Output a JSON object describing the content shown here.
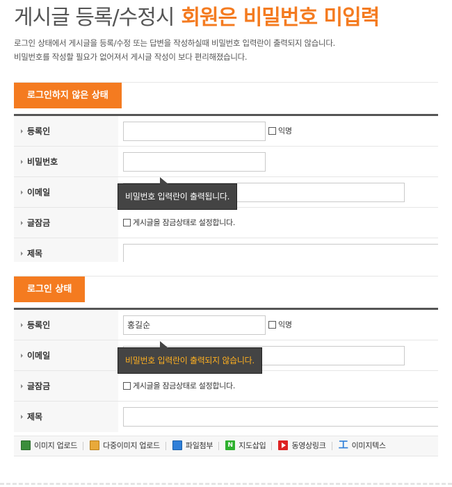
{
  "header": {
    "title_gray": "게시글 등록/수정시",
    "title_orange": "회원은 비밀번호 미입력"
  },
  "description": {
    "line1": "로그인 상태에서 게시글을 등록/수정 또는 답변을 작성하실때 비밀번호 입력란이 출력되지 않습니다.",
    "line2": "비밀번호를 작성할 필요가 없어져서 게시글 작성이 보다 편리해졌습니다."
  },
  "panel_logged_out": {
    "tag": "로그인하지 않은 상태",
    "rows": {
      "author": "등록인",
      "password": "비밀번호",
      "email": "이메일",
      "lock": "글잠금",
      "subject": "제목"
    },
    "anonymous_label": "익명",
    "lock_checkbox_label": "게시글을 잠금상태로 설정합니다.",
    "tooltip": "비밀번호 입력란이 출력됩니다."
  },
  "panel_logged_in": {
    "tag": "로그인 상태",
    "rows": {
      "author": "등록인",
      "email": "이메일",
      "lock": "글잠금",
      "subject": "제목"
    },
    "author_value": "홍길순",
    "anonymous_label": "익명",
    "lock_checkbox_label": "게시글을 잠금상태로 설정합니다.",
    "tooltip": "비밀번호 입력란이 출력되지 않습니다."
  },
  "toolbar": {
    "image_upload": "이미지 업로드",
    "multi_image_upload": "다중이미지 업로드",
    "file_attach": "파일첨부",
    "map_insert": "지도삽입",
    "map_icon_letter": "N",
    "video_link": "동영상링크",
    "image_text": "이미지텍스"
  },
  "colors": {
    "accent": "#f47b20",
    "tooltip_bg": "#444444",
    "tooltip_highlight": "#ffb020"
  },
  "icons": {
    "image_upload": "image-icon",
    "multi_image_upload": "folder-images-icon",
    "file_attach": "file-icon",
    "map_insert": "naver-map-icon",
    "video_link": "video-icon",
    "image_text": "text-image-icon"
  }
}
